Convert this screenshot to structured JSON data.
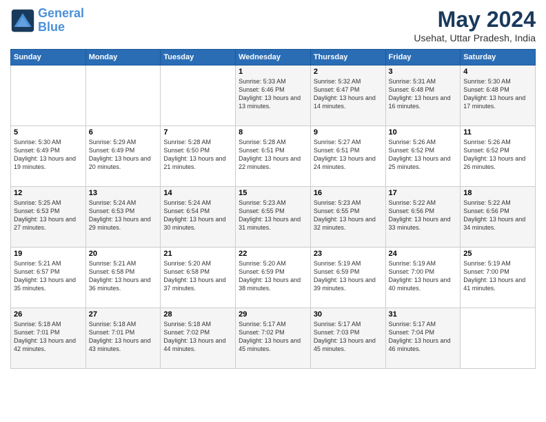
{
  "logo": {
    "line1": "General",
    "line2": "Blue"
  },
  "title": "May 2024",
  "subtitle": "Usehat, Uttar Pradesh, India",
  "days_of_week": [
    "Sunday",
    "Monday",
    "Tuesday",
    "Wednesday",
    "Thursday",
    "Friday",
    "Saturday"
  ],
  "weeks": [
    [
      {
        "num": "",
        "sunrise": "",
        "sunset": "",
        "daylight": ""
      },
      {
        "num": "",
        "sunrise": "",
        "sunset": "",
        "daylight": ""
      },
      {
        "num": "",
        "sunrise": "",
        "sunset": "",
        "daylight": ""
      },
      {
        "num": "1",
        "sunrise": "5:33 AM",
        "sunset": "6:46 PM",
        "daylight": "13 hours and 13 minutes."
      },
      {
        "num": "2",
        "sunrise": "5:32 AM",
        "sunset": "6:47 PM",
        "daylight": "13 hours and 14 minutes."
      },
      {
        "num": "3",
        "sunrise": "5:31 AM",
        "sunset": "6:48 PM",
        "daylight": "13 hours and 16 minutes."
      },
      {
        "num": "4",
        "sunrise": "5:30 AM",
        "sunset": "6:48 PM",
        "daylight": "13 hours and 17 minutes."
      }
    ],
    [
      {
        "num": "5",
        "sunrise": "5:30 AM",
        "sunset": "6:49 PM",
        "daylight": "13 hours and 19 minutes."
      },
      {
        "num": "6",
        "sunrise": "5:29 AM",
        "sunset": "6:49 PM",
        "daylight": "13 hours and 20 minutes."
      },
      {
        "num": "7",
        "sunrise": "5:28 AM",
        "sunset": "6:50 PM",
        "daylight": "13 hours and 21 minutes."
      },
      {
        "num": "8",
        "sunrise": "5:28 AM",
        "sunset": "6:51 PM",
        "daylight": "13 hours and 22 minutes."
      },
      {
        "num": "9",
        "sunrise": "5:27 AM",
        "sunset": "6:51 PM",
        "daylight": "13 hours and 24 minutes."
      },
      {
        "num": "10",
        "sunrise": "5:26 AM",
        "sunset": "6:52 PM",
        "daylight": "13 hours and 25 minutes."
      },
      {
        "num": "11",
        "sunrise": "5:26 AM",
        "sunset": "6:52 PM",
        "daylight": "13 hours and 26 minutes."
      }
    ],
    [
      {
        "num": "12",
        "sunrise": "5:25 AM",
        "sunset": "6:53 PM",
        "daylight": "13 hours and 27 minutes."
      },
      {
        "num": "13",
        "sunrise": "5:24 AM",
        "sunset": "6:53 PM",
        "daylight": "13 hours and 29 minutes."
      },
      {
        "num": "14",
        "sunrise": "5:24 AM",
        "sunset": "6:54 PM",
        "daylight": "13 hours and 30 minutes."
      },
      {
        "num": "15",
        "sunrise": "5:23 AM",
        "sunset": "6:55 PM",
        "daylight": "13 hours and 31 minutes."
      },
      {
        "num": "16",
        "sunrise": "5:23 AM",
        "sunset": "6:55 PM",
        "daylight": "13 hours and 32 minutes."
      },
      {
        "num": "17",
        "sunrise": "5:22 AM",
        "sunset": "6:56 PM",
        "daylight": "13 hours and 33 minutes."
      },
      {
        "num": "18",
        "sunrise": "5:22 AM",
        "sunset": "6:56 PM",
        "daylight": "13 hours and 34 minutes."
      }
    ],
    [
      {
        "num": "19",
        "sunrise": "5:21 AM",
        "sunset": "6:57 PM",
        "daylight": "13 hours and 35 minutes."
      },
      {
        "num": "20",
        "sunrise": "5:21 AM",
        "sunset": "6:58 PM",
        "daylight": "13 hours and 36 minutes."
      },
      {
        "num": "21",
        "sunrise": "5:20 AM",
        "sunset": "6:58 PM",
        "daylight": "13 hours and 37 minutes."
      },
      {
        "num": "22",
        "sunrise": "5:20 AM",
        "sunset": "6:59 PM",
        "daylight": "13 hours and 38 minutes."
      },
      {
        "num": "23",
        "sunrise": "5:19 AM",
        "sunset": "6:59 PM",
        "daylight": "13 hours and 39 minutes."
      },
      {
        "num": "24",
        "sunrise": "5:19 AM",
        "sunset": "7:00 PM",
        "daylight": "13 hours and 40 minutes."
      },
      {
        "num": "25",
        "sunrise": "5:19 AM",
        "sunset": "7:00 PM",
        "daylight": "13 hours and 41 minutes."
      }
    ],
    [
      {
        "num": "26",
        "sunrise": "5:18 AM",
        "sunset": "7:01 PM",
        "daylight": "13 hours and 42 minutes."
      },
      {
        "num": "27",
        "sunrise": "5:18 AM",
        "sunset": "7:01 PM",
        "daylight": "13 hours and 43 minutes."
      },
      {
        "num": "28",
        "sunrise": "5:18 AM",
        "sunset": "7:02 PM",
        "daylight": "13 hours and 44 minutes."
      },
      {
        "num": "29",
        "sunrise": "5:17 AM",
        "sunset": "7:02 PM",
        "daylight": "13 hours and 45 minutes."
      },
      {
        "num": "30",
        "sunrise": "5:17 AM",
        "sunset": "7:03 PM",
        "daylight": "13 hours and 45 minutes."
      },
      {
        "num": "31",
        "sunrise": "5:17 AM",
        "sunset": "7:04 PM",
        "daylight": "13 hours and 46 minutes."
      },
      {
        "num": "",
        "sunrise": "",
        "sunset": "",
        "daylight": ""
      }
    ]
  ]
}
